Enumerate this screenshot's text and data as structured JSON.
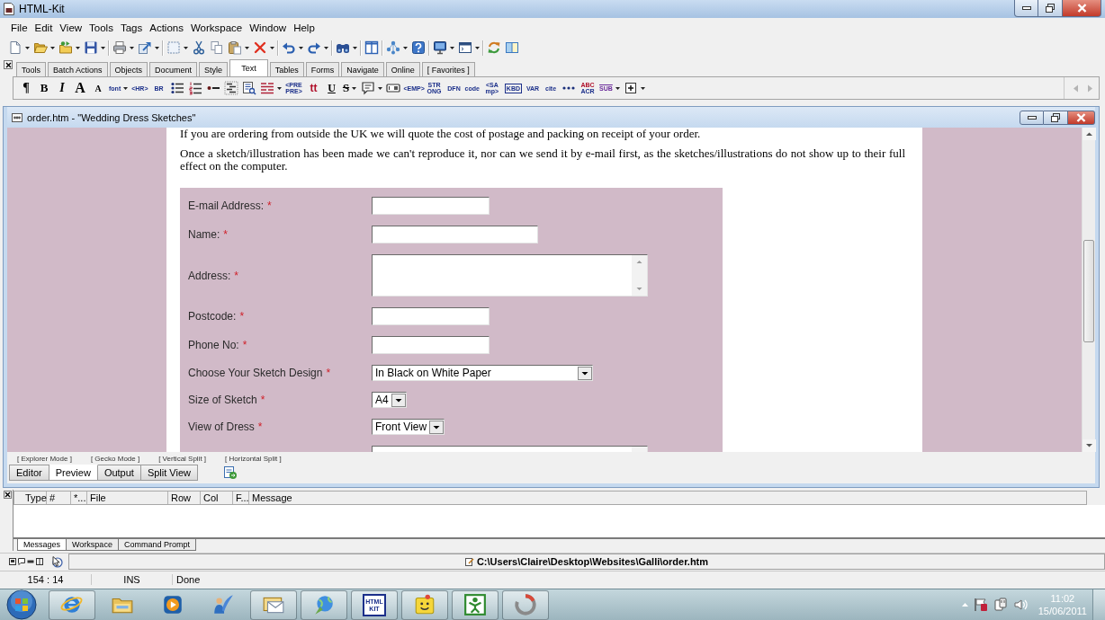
{
  "app_window": {
    "title": "HTML-Kit"
  },
  "menu_bar": [
    "File",
    "Edit",
    "View",
    "Tools",
    "Tags",
    "Actions",
    "Workspace",
    "Window",
    "Help"
  ],
  "toolbar": [
    {
      "kind": "newfile",
      "menu": true
    },
    {
      "kind": "open",
      "menu": true
    },
    {
      "kind": "project",
      "menu": true
    },
    {
      "kind": "save",
      "menu": true
    },
    {
      "kind": "separator"
    },
    {
      "kind": "print",
      "menu": true
    },
    {
      "kind": "publish",
      "menu": true
    },
    {
      "kind": "separator"
    },
    {
      "kind": "select",
      "menu": true
    },
    {
      "kind": "cut",
      "menu": false
    },
    {
      "kind": "copy",
      "menu": false
    },
    {
      "kind": "paste",
      "menu": true
    },
    {
      "kind": "delete",
      "menu": true
    },
    {
      "kind": "separator"
    },
    {
      "kind": "undo",
      "menu": true
    },
    {
      "kind": "redo",
      "menu": true
    },
    {
      "kind": "separator"
    },
    {
      "kind": "find",
      "menu": true
    },
    {
      "kind": "separator"
    },
    {
      "kind": "panel",
      "menu": false
    },
    {
      "kind": "separator"
    },
    {
      "kind": "network",
      "menu": true
    },
    {
      "kind": "help",
      "menu": false
    },
    {
      "kind": "separator"
    },
    {
      "kind": "monitor",
      "menu": true
    },
    {
      "kind": "window",
      "menu": true
    },
    {
      "kind": "separator"
    },
    {
      "kind": "sync",
      "menu": false
    },
    {
      "kind": "split",
      "menu": false
    }
  ],
  "palette_tabs": [
    {
      "label": "Tools",
      "selected": false
    },
    {
      "label": "Batch Actions",
      "selected": false
    },
    {
      "label": "Objects",
      "selected": false
    },
    {
      "label": "Document",
      "selected": false
    },
    {
      "label": "Style",
      "selected": false
    },
    {
      "label": "Text",
      "selected": true
    },
    {
      "label": "Tables",
      "selected": false
    },
    {
      "label": "Forms",
      "selected": false
    },
    {
      "label": "Navigate",
      "selected": false
    },
    {
      "label": "Online",
      "selected": false
    },
    {
      "label": "[ Favorites ]",
      "selected": false
    }
  ],
  "text_toolbar": [
    {
      "kind": "pilcrow",
      "label": "¶",
      "menu": false
    },
    {
      "kind": "bold",
      "label": "B",
      "menu": false
    },
    {
      "kind": "italic",
      "label": "I",
      "menu": false
    },
    {
      "kind": "big",
      "label": "A",
      "menu": false
    },
    {
      "kind": "small",
      "label": "A",
      "menu": false
    },
    {
      "kind": "tag",
      "label": "font",
      "menu": true
    },
    {
      "kind": "tag",
      "label": "<HR>",
      "menu": false
    },
    {
      "kind": "tag",
      "label": "BR",
      "menu": false
    },
    {
      "kind": "bullets",
      "menu": false
    },
    {
      "kind": "numbers",
      "menu": false
    },
    {
      "kind": "dash",
      "menu": false
    },
    {
      "kind": "deflist",
      "menu": false
    },
    {
      "kind": "findpage",
      "menu": false
    },
    {
      "kind": "textstyle",
      "menu": true
    },
    {
      "kind": "tag",
      "label": "<PRE PRE>",
      "menu": false
    },
    {
      "kind": "red",
      "label": "tt",
      "menu": false
    },
    {
      "kind": "underline",
      "label": "U",
      "menu": false
    },
    {
      "kind": "strike",
      "label": "S",
      "menu": true
    },
    {
      "kind": "comment",
      "menu": true
    },
    {
      "kind": "field",
      "menu": false
    },
    {
      "kind": "tag",
      "label": "<EMP>",
      "menu": false
    },
    {
      "kind": "tag",
      "label": "STR ONG",
      "menu": false
    },
    {
      "kind": "tag",
      "label": "DFN",
      "menu": false
    },
    {
      "kind": "tag",
      "label": "code",
      "menu": false
    },
    {
      "kind": "tag",
      "label": "<SA mp>",
      "menu": false
    },
    {
      "kind": "boxed",
      "label": "KBD",
      "menu": false
    },
    {
      "kind": "tag",
      "label": "VAR",
      "menu": false
    },
    {
      "kind": "tag",
      "label": "cite",
      "menu": false
    },
    {
      "kind": "ellipsis",
      "menu": false
    },
    {
      "kind": "acronym",
      "label": "ABC ACR",
      "menu": false
    },
    {
      "kind": "overline",
      "label": "SUB",
      "menu": true
    },
    {
      "kind": "plusbox",
      "menu": true
    }
  ],
  "document": {
    "title": "order.htm - \"Wedding Dress Sketches\"",
    "paragraphs": [
      "If you are ordering from outside the UK we will quote the cost of postage and packing on receipt of your order.",
      "Once a sketch/illustration has been made we can't reproduce it, nor can we send it by e-mail first, as the sketches/illustrations do not show up to their full effect on the computer."
    ],
    "form": [
      {
        "kind": "input",
        "label": "E-mail Address:",
        "required_mark": "*"
      },
      {
        "kind": "wideinput",
        "label": "Name:",
        "required_mark": "*"
      },
      {
        "kind": "textarea",
        "label": "Address:",
        "required_mark": "*"
      },
      {
        "kind": "input",
        "label": "Postcode:",
        "required_mark": "*"
      },
      {
        "kind": "input",
        "label": "Phone No:",
        "required_mark": "*"
      },
      {
        "kind": "wideselect",
        "label": "Choose Your Sketch Design",
        "required_mark": "*",
        "value": "In Black on White Paper"
      },
      {
        "kind": "select",
        "label": "Size of Sketch",
        "required_mark": "*",
        "value": "A4"
      },
      {
        "kind": "select",
        "label": "View of Dress",
        "required_mark": "*",
        "value": "Front View"
      },
      {
        "kind": "textarea"
      }
    ],
    "view_modes": [
      "[ Explorer Mode ]",
      "[ Gecko Mode ]",
      "[ Vertical Split ]",
      "[ Horizontal Split ]"
    ],
    "view_tabs": [
      {
        "label": "Editor",
        "selected": false
      },
      {
        "label": "Preview",
        "selected": true
      },
      {
        "label": "Output",
        "selected": false
      },
      {
        "label": "Split View",
        "selected": false
      }
    ]
  },
  "messages": {
    "columns": [
      "Type",
      "#",
      "*...",
      "File",
      "Row",
      "Col",
      "F...",
      "Message"
    ],
    "tabs": [
      {
        "label": "Messages",
        "selected": true
      },
      {
        "label": "Workspace",
        "selected": false
      },
      {
        "label": "Command Prompt",
        "selected": false
      }
    ]
  },
  "status": {
    "path": "C:\\Users\\Claire\\Desktop\\Websites\\Galli\\order.htm",
    "position": "154 : 14",
    "mode": "INS",
    "state": "Done"
  },
  "taskbar": {
    "apps": [
      {
        "kind": "ie",
        "running": true
      },
      {
        "kind": "explorer",
        "running": false
      },
      {
        "kind": "media",
        "running": false
      },
      {
        "kind": "quill",
        "running": false
      },
      {
        "kind": "mail",
        "running": true
      },
      {
        "kind": "globe",
        "running": true
      },
      {
        "kind": "htmlkit",
        "running": true,
        "label": "HTML KIT"
      },
      {
        "kind": "smiley",
        "running": true
      },
      {
        "kind": "figure",
        "running": true
      },
      {
        "kind": "ring",
        "running": true
      }
    ],
    "time": "11:02",
    "date": "15/06/2011"
  }
}
